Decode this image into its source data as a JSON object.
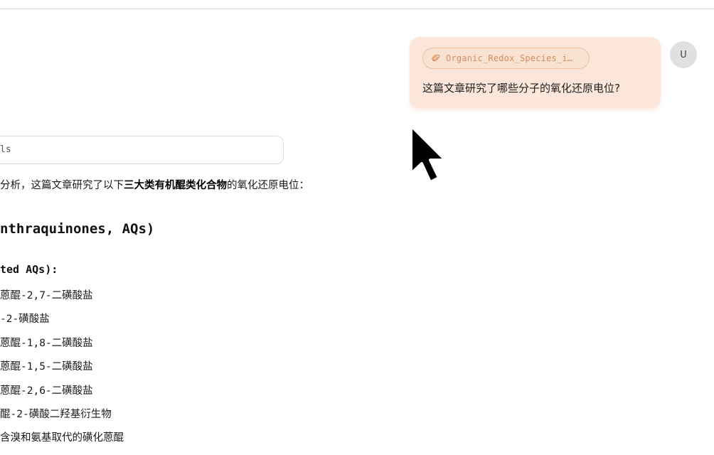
{
  "user_message": {
    "attachment_name": "Organic_Redox_Species_i…",
    "text": "这篇文章研究了哪些分子的氧化还原电位?",
    "avatar_initial": "U"
  },
  "assistant": {
    "tool_box_text": "ls",
    "intro_prefix": "分析，这篇文章研究了以下",
    "intro_bold": "三大类有机醌类化合物",
    "intro_suffix": "的氧化还原电位：",
    "heading": "nthraquinones, AQs)",
    "subheading": "ted AQs):",
    "items": [
      "蒽醌-2,7-二磺酸盐",
      "-2-磺酸盐",
      "蒽醌-1,8-二磺酸盐",
      "蒽醌-1,5-二磺酸盐",
      "蒽醌-2,6-二磺酸盐",
      "醌-2-磺酸二羟基衍生物",
      "含溴和氨基取代的磺化蒽醌"
    ]
  },
  "colors": {
    "bubble_bg": "#fbe6d9",
    "chip_border": "#ecc0a3",
    "chip_text": "#d48a5b",
    "avatar_bg": "#e0e0e0"
  },
  "icons": {
    "attachment": "paperclip-icon",
    "cursor": "mouse-pointer-icon"
  }
}
